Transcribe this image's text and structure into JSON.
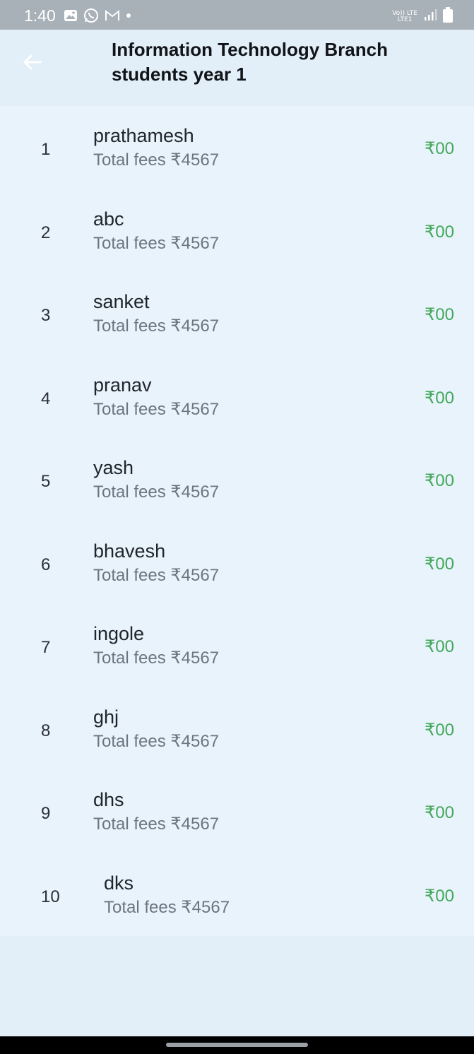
{
  "status_bar": {
    "time": "1:40",
    "net_top": "Vo)) LTE",
    "net_bottom": "LTE1",
    "icons": [
      "gallery-icon",
      "whatsapp-icon",
      "gmail-icon",
      "dot-icon",
      "signal-icon",
      "battery-icon"
    ]
  },
  "app_bar": {
    "title": "Information Technology Branch students year 1",
    "back_icon": "arrow-left-icon"
  },
  "colors": {
    "status_bar": "#a8b0b8",
    "app_bar": "#e2eef8",
    "list_bg": "#e8f3fc",
    "amount": "#43a85a",
    "subtitle": "#6c7580"
  },
  "students": [
    {
      "index": "1",
      "name": "prathamesh",
      "subtitle": "Total fees ₹4567",
      "amount": "₹00"
    },
    {
      "index": "2",
      "name": "abc",
      "subtitle": "Total fees ₹4567",
      "amount": "₹00"
    },
    {
      "index": "3",
      "name": "sanket",
      "subtitle": "Total fees ₹4567",
      "amount": "₹00"
    },
    {
      "index": "4",
      "name": "pranav",
      "subtitle": "Total fees ₹4567",
      "amount": "₹00"
    },
    {
      "index": "5",
      "name": "yash",
      "subtitle": "Total fees ₹4567",
      "amount": "₹00"
    },
    {
      "index": "6",
      "name": "bhavesh",
      "subtitle": "Total fees ₹4567",
      "amount": "₹00"
    },
    {
      "index": "7",
      "name": "ingole",
      "subtitle": "Total fees ₹4567",
      "amount": "₹00"
    },
    {
      "index": "8",
      "name": "ghj",
      "subtitle": "Total fees ₹4567",
      "amount": "₹00"
    },
    {
      "index": "9",
      "name": "dhs",
      "subtitle": "Total fees ₹4567",
      "amount": "₹00"
    },
    {
      "index": "10",
      "name": "dks",
      "subtitle": "Total fees ₹4567",
      "amount": "₹00"
    }
  ]
}
